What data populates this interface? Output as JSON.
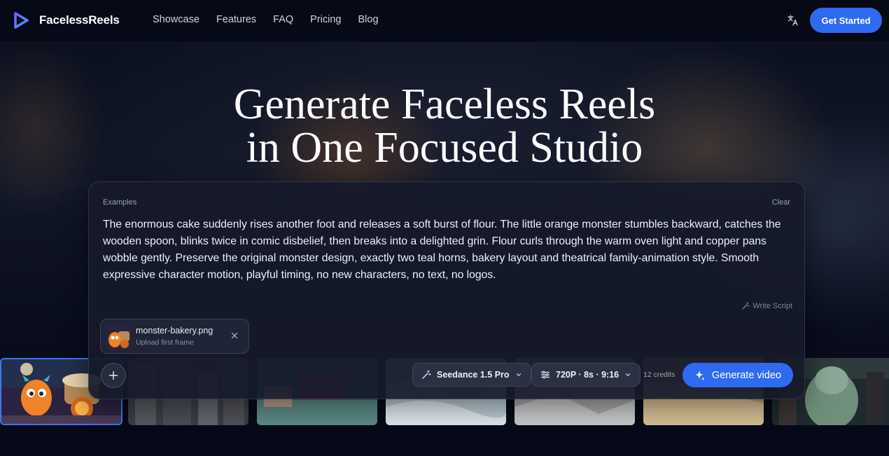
{
  "nav": {
    "brand": "FacelessReels",
    "links": [
      "Showcase",
      "Features",
      "FAQ",
      "Pricing",
      "Blog"
    ],
    "cta": "Get Started"
  },
  "hero": {
    "title_line1": "Generate Faceless Reels",
    "title_line2": "in One Focused Studio"
  },
  "prompt_card": {
    "examples_label": "Examples",
    "clear_label": "Clear",
    "prompt_text": "The enormous cake suddenly rises another foot and releases a soft burst of flour. The little orange monster stumbles backward, catches the wooden spoon, blinks twice in comic disbelief, then breaks into a delighted grin. Flour curls through the warm oven light and copper pans wobble gently. Preserve the original monster design, exactly two teal horns, bakery layout and theatrical family-animation style. Smooth expressive character motion, playful timing, no new characters, no text, no logos.",
    "write_script_label": "Write Script",
    "file": {
      "name": "monster-bakery.png",
      "subtitle": "Upload first frame"
    },
    "model_label": "Seedance 1.5 Pro",
    "settings_label": "720P · 8s · 9:16",
    "credits_label": "12 credits",
    "generate_label": "Generate video"
  },
  "colors": {
    "accent": "#2f6bf0",
    "background": "#070b1a",
    "card": "#161a2a"
  },
  "icons": [
    "logo-play-icon",
    "translate-icon",
    "close-icon",
    "plus-icon",
    "magic-wand-icon",
    "sliders-icon",
    "chevron-down-icon",
    "sparkle-icon"
  ]
}
